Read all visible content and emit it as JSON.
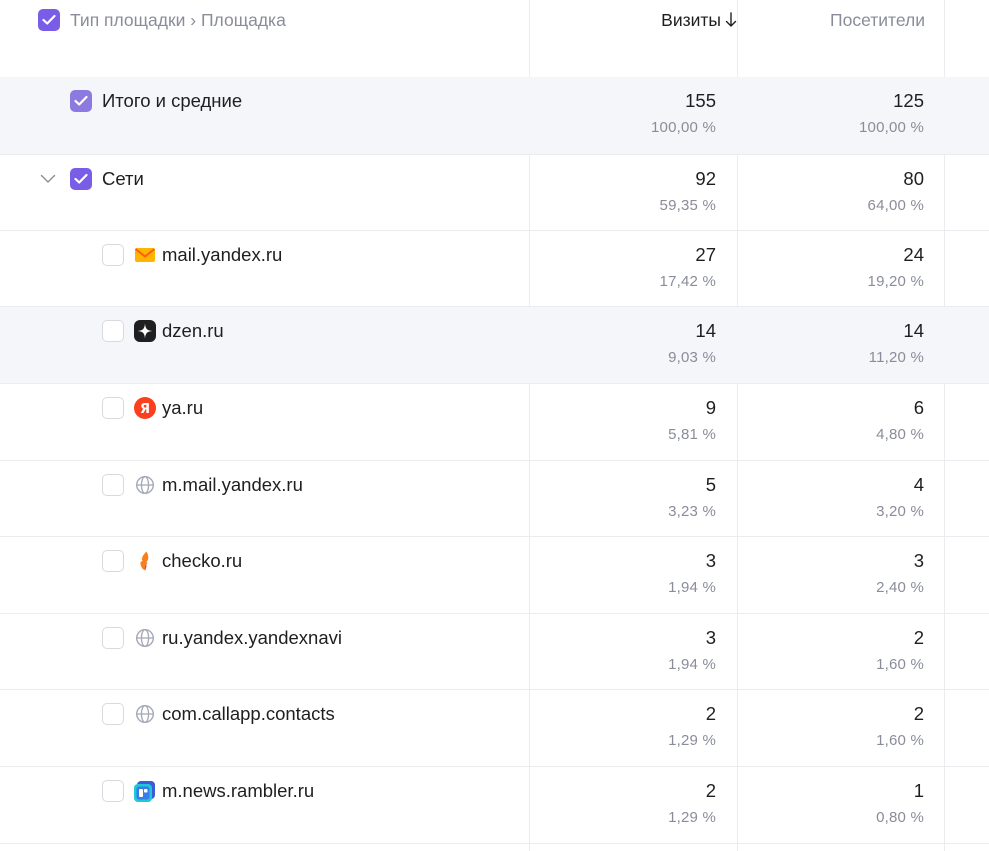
{
  "header": {
    "dimension_title": "Тип площадки › Площадка",
    "visits_label": "Визиты",
    "visitors_label": "Посетители"
  },
  "total": {
    "label": "Итого и средние",
    "visits": "155",
    "visits_pct": "100,00 %",
    "visitors": "125",
    "visitors_pct": "100,00 %"
  },
  "group": {
    "label": "Сети",
    "visits": "92",
    "visits_pct": "59,35 %",
    "visitors": "80",
    "visitors_pct": "64,00 %"
  },
  "rows": [
    {
      "label": "mail.yandex.ru",
      "icon": "mail-envelope-icon",
      "visits": "27",
      "visits_pct": "17,42 %",
      "visitors": "24",
      "visitors_pct": "19,20 %"
    },
    {
      "label": "dzen.ru",
      "icon": "dzen-star-icon",
      "visits": "14",
      "visits_pct": "9,03 %",
      "visitors": "14",
      "visitors_pct": "11,20 %"
    },
    {
      "label": "ya.ru",
      "icon": "yandex-logo-icon",
      "visits": "9",
      "visits_pct": "5,81 %",
      "visitors": "6",
      "visitors_pct": "4,80 %"
    },
    {
      "label": "m.mail.yandex.ru",
      "icon": "globe-icon",
      "visits": "5",
      "visits_pct": "3,23 %",
      "visitors": "4",
      "visitors_pct": "3,20 %"
    },
    {
      "label": "checko.ru",
      "icon": "checko-flame-icon",
      "visits": "3",
      "visits_pct": "1,94 %",
      "visitors": "3",
      "visitors_pct": "2,40 %"
    },
    {
      "label": "ru.yandex.yandexnavi",
      "icon": "globe-icon",
      "visits": "3",
      "visits_pct": "1,94 %",
      "visitors": "2",
      "visitors_pct": "1,60 %"
    },
    {
      "label": "com.callapp.contacts",
      "icon": "globe-icon",
      "visits": "2",
      "visits_pct": "1,29 %",
      "visitors": "2",
      "visitors_pct": "1,60 %"
    },
    {
      "label": "m.news.rambler.ru",
      "icon": "rambler-news-icon",
      "visits": "2",
      "visits_pct": "1,29 %",
      "visitors": "1",
      "visitors_pct": "0,80 %"
    }
  ],
  "colors": {
    "checkbox_accent": "#7a5de6",
    "shaded_row": "#f5f6f9",
    "muted_text": "#8a8d99"
  }
}
